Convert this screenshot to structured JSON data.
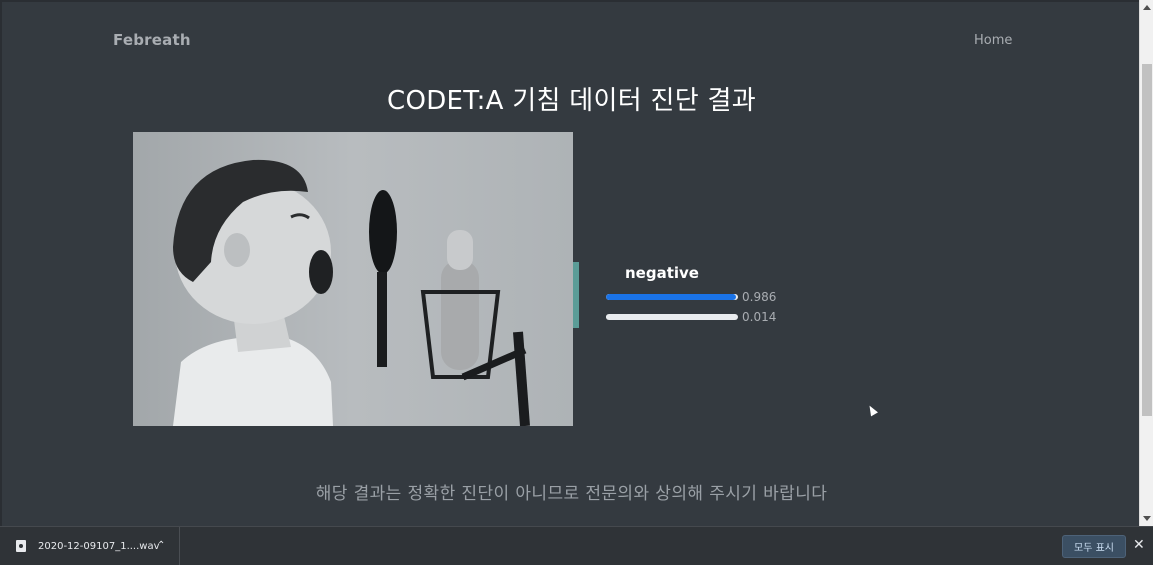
{
  "nav": {
    "brand": "Febreath",
    "home": "Home"
  },
  "title": "CODET:A 기침 데이터 진단 결과",
  "result": {
    "label": "negative",
    "bars": [
      {
        "value": 0.986,
        "value_text": "0.986",
        "color": "#1a73e8"
      },
      {
        "value": 0.014,
        "value_text": "0.014",
        "color": "#e9ecef"
      }
    ]
  },
  "disclaimer": "해당 결과는 정확한 진단이 아니므로 전문의와 상의해 주시기 바랍니다",
  "downloads": {
    "file_name": "2020-12-09107_1....wav",
    "show_all": "모두 표시",
    "close": "✕"
  },
  "colors": {
    "background": "#343a40",
    "accent": "#5b9c97"
  }
}
